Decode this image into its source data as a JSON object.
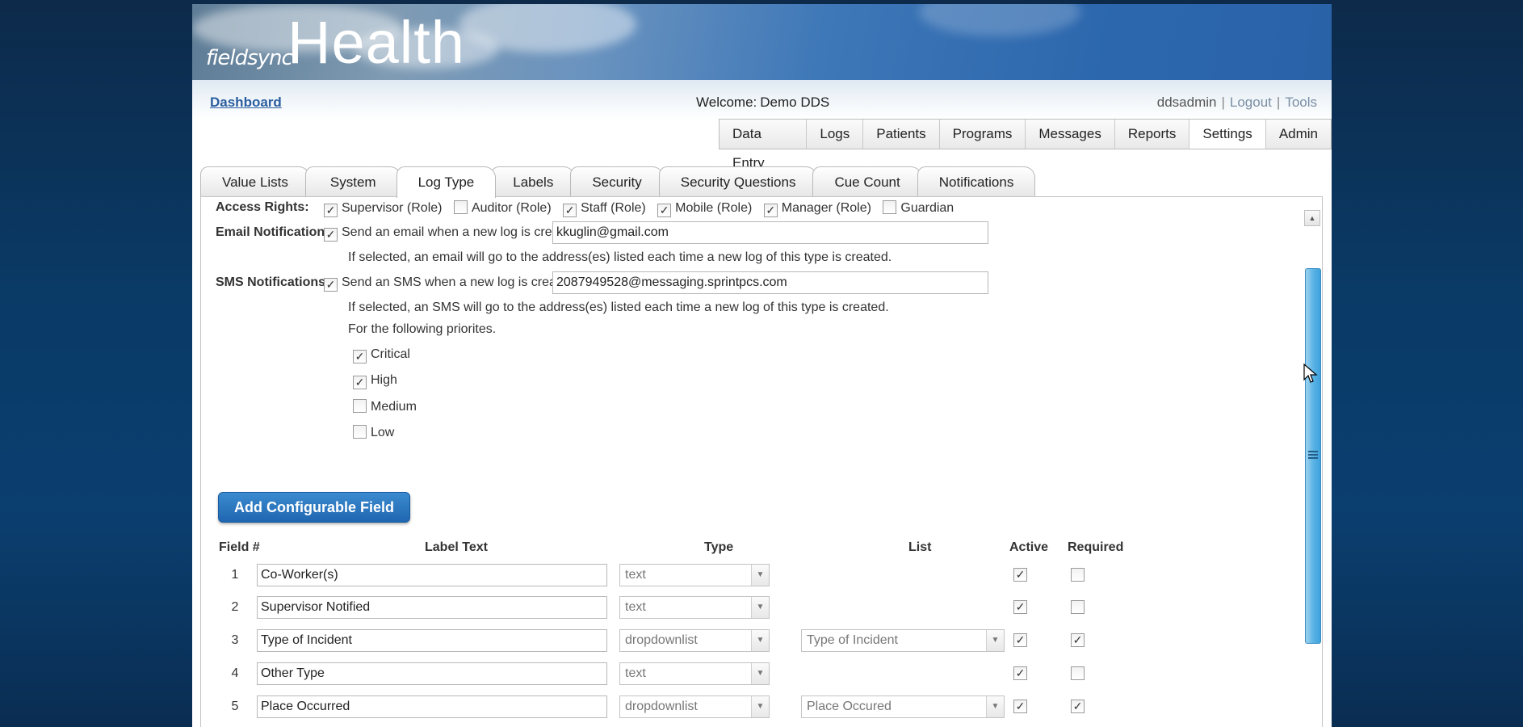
{
  "banner": {
    "logo_small": "fieldsync",
    "logo_big": "Health"
  },
  "header": {
    "dashboard": "Dashboard",
    "welcome_prefix": "Welcome:",
    "welcome_name": "Demo DDS",
    "username": "ddsadmin",
    "logout": "Logout",
    "tools": "Tools",
    "separator": "|"
  },
  "topnav": {
    "items": [
      "Data Entry",
      "Logs",
      "Patients",
      "Programs",
      "Messages",
      "Reports",
      "Settings",
      "Admin"
    ],
    "active": "Settings"
  },
  "tabs": {
    "items": [
      "Value Lists",
      "System",
      "Log Type",
      "Labels",
      "Security",
      "Security Questions",
      "Cue Count",
      "Notifications"
    ],
    "active": "Log Type"
  },
  "access_rights": {
    "label": "Access Rights:",
    "roles": [
      {
        "label": "Supervisor (Role)",
        "checked": true
      },
      {
        "label": "Auditor (Role)",
        "checked": false
      },
      {
        "label": "Staff (Role)",
        "checked": true
      },
      {
        "label": "Mobile (Role)",
        "checked": true
      },
      {
        "label": "Manager (Role)",
        "checked": true
      },
      {
        "label": "Guardian",
        "checked": false
      }
    ]
  },
  "email": {
    "label": "Email Notifications:",
    "checkbox_label": "Send an email when a new log is created",
    "checked": true,
    "value": "kkuglin@gmail.com",
    "help": "If selected, an email will go to the address(es) listed each time a new log of this type is created."
  },
  "sms": {
    "label": "SMS Notifications:",
    "checkbox_label": "Send an SMS when a new log is created",
    "checked": true,
    "value": "2087949528@messaging.sprintpcs.com",
    "help": "If selected, an SMS will go to the address(es) listed each time a new log of this type is created.",
    "priorities_intro": "For the following priorites.",
    "priorities": [
      {
        "label": "Critical",
        "checked": true
      },
      {
        "label": "High",
        "checked": true
      },
      {
        "label": "Medium",
        "checked": false
      },
      {
        "label": "Low",
        "checked": false
      }
    ]
  },
  "add_button": "Add Configurable Field",
  "table": {
    "headers": {
      "field": "Field #",
      "label": "Label Text",
      "type": "Type",
      "list": "List",
      "active": "Active",
      "required": "Required"
    },
    "rows": [
      {
        "num": "1",
        "label": "Co-Worker(s)",
        "type": "text",
        "list": "",
        "active": true,
        "required": false
      },
      {
        "num": "2",
        "label": "Supervisor Notified",
        "type": "text",
        "list": "",
        "active": true,
        "required": false
      },
      {
        "num": "3",
        "label": "Type of Incident",
        "type": "dropdownlist",
        "list": "Type of Incident",
        "active": true,
        "required": true
      },
      {
        "num": "4",
        "label": "Other Type",
        "type": "text",
        "list": "",
        "active": true,
        "required": false
      },
      {
        "num": "5",
        "label": "Place Occurred",
        "type": "dropdownlist",
        "list": "Place Occured",
        "active": true,
        "required": true
      }
    ]
  },
  "icons": {
    "check": "✓",
    "dropdown": "▼",
    "scroll_up": "▲"
  },
  "colors": {
    "accent": "#1f67b0",
    "link": "#2a5d9f",
    "scroll_thumb": "#5cb4e6"
  }
}
